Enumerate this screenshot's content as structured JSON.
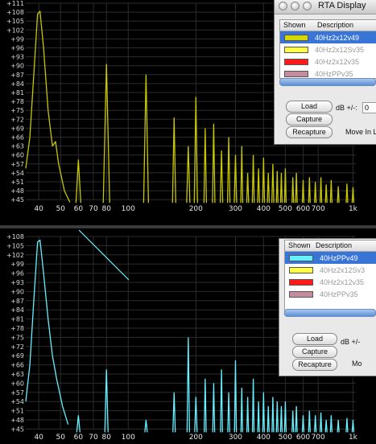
{
  "top_pane": {
    "y_ticks": [
      "+111",
      "+108",
      "+105",
      "+102",
      "+99",
      "+96",
      "+93",
      "+90",
      "+87",
      "+84",
      "+81",
      "+78",
      "+75",
      "+72",
      "+69",
      "+66",
      "+63",
      "+60",
      "+57",
      "+54",
      "+51",
      "+48",
      "+45"
    ],
    "x_ticks": [
      "40",
      "50",
      "60",
      "70",
      "80",
      "100",
      "200",
      "300",
      "400",
      "500",
      "600",
      "700",
      "1k"
    ],
    "trace_color": "#c8c800",
    "rta": {
      "title": "RTA Display",
      "col_shown": "Shown",
      "col_description": "Description",
      "items": [
        {
          "description": "40Hz2x12v49",
          "color": "#d6d600",
          "selected": true
        },
        {
          "description": "40Hz2x12Sv35",
          "color": "#ffff40",
          "selected": false
        },
        {
          "description": "40Hz2x12v35",
          "color": "#ff1a1a",
          "selected": false
        },
        {
          "description": "40HzPPv35",
          "color": "#c78ba0",
          "selected": false
        }
      ],
      "load_label": "Load",
      "capture_label": "Capture",
      "recapture_label": "Recapture",
      "db_label": "dB +/-:",
      "db_value": "0",
      "move_label": "Move In L"
    }
  },
  "bottom_pane": {
    "y_ticks": [
      "+108",
      "+105",
      "+102",
      "+99",
      "+96",
      "+93",
      "+90",
      "+87",
      "+84",
      "+81",
      "+78",
      "+75",
      "+72",
      "+69",
      "+66",
      "+63",
      "+60",
      "+57",
      "+54",
      "+51",
      "+48",
      "+45"
    ],
    "x_ticks": [
      "40",
      "50",
      "60",
      "70",
      "80",
      "100",
      "200",
      "300",
      "400",
      "500",
      "600",
      "700",
      "1k"
    ],
    "trace_color": "#66f0ff",
    "rta": {
      "col_shown": "Shown",
      "col_description": "Description",
      "items": [
        {
          "description": "40HzPPv49",
          "color": "#66f0ff",
          "selected": true
        },
        {
          "description": "40Hz2x12Sv3",
          "color": "#ffff40",
          "selected": false
        },
        {
          "description": "40Hz2x12v35",
          "color": "#ff1a1a",
          "selected": false
        },
        {
          "description": "40HzPPv35",
          "color": "#c78ba0",
          "selected": false
        }
      ],
      "load_label": "Load",
      "capture_label": "Capture",
      "recapture_label": "Recapture",
      "db_label": "dB +/-",
      "move_label": "Mo"
    }
  }
}
